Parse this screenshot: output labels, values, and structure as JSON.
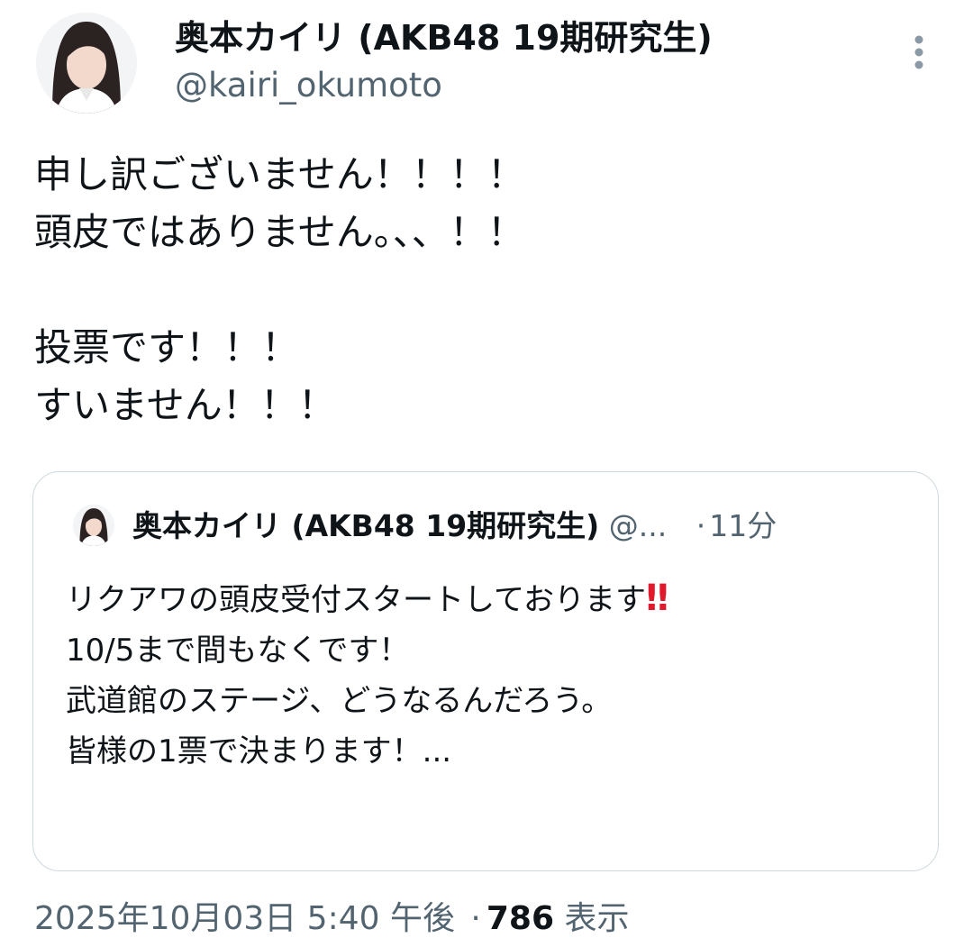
{
  "author": {
    "name": "奥本カイリ (AKB48 19期研究生)",
    "handle": "@kairi_okumoto"
  },
  "tweet": {
    "text": "申し訳ございません！！！！\n頭皮ではありません。、、！！\n\n投票です！！！\nすいません！！！"
  },
  "quoted": {
    "name": "奥本カイリ (AKB48 19期研究生)",
    "handle": "@...",
    "separator": "·",
    "time": "11分",
    "line1": "リクアワの頭皮受付スタートしております",
    "emoji": "‼",
    "rest": "\n10/5まで間もなくです！\n武道館のステージ、どうなるんだろう。\n皆様の1票で決まります！..."
  },
  "meta": {
    "date": "2025年10月03日 5:40 午後",
    "separator": "·",
    "views_count": "786",
    "views_label": "表示"
  },
  "icons": {
    "more": "more-vertical-icon"
  },
  "colors": {
    "text": "#0f1419",
    "secondary": "#536471",
    "border": "#cfd9de",
    "emoji_red": "#e0192d"
  }
}
